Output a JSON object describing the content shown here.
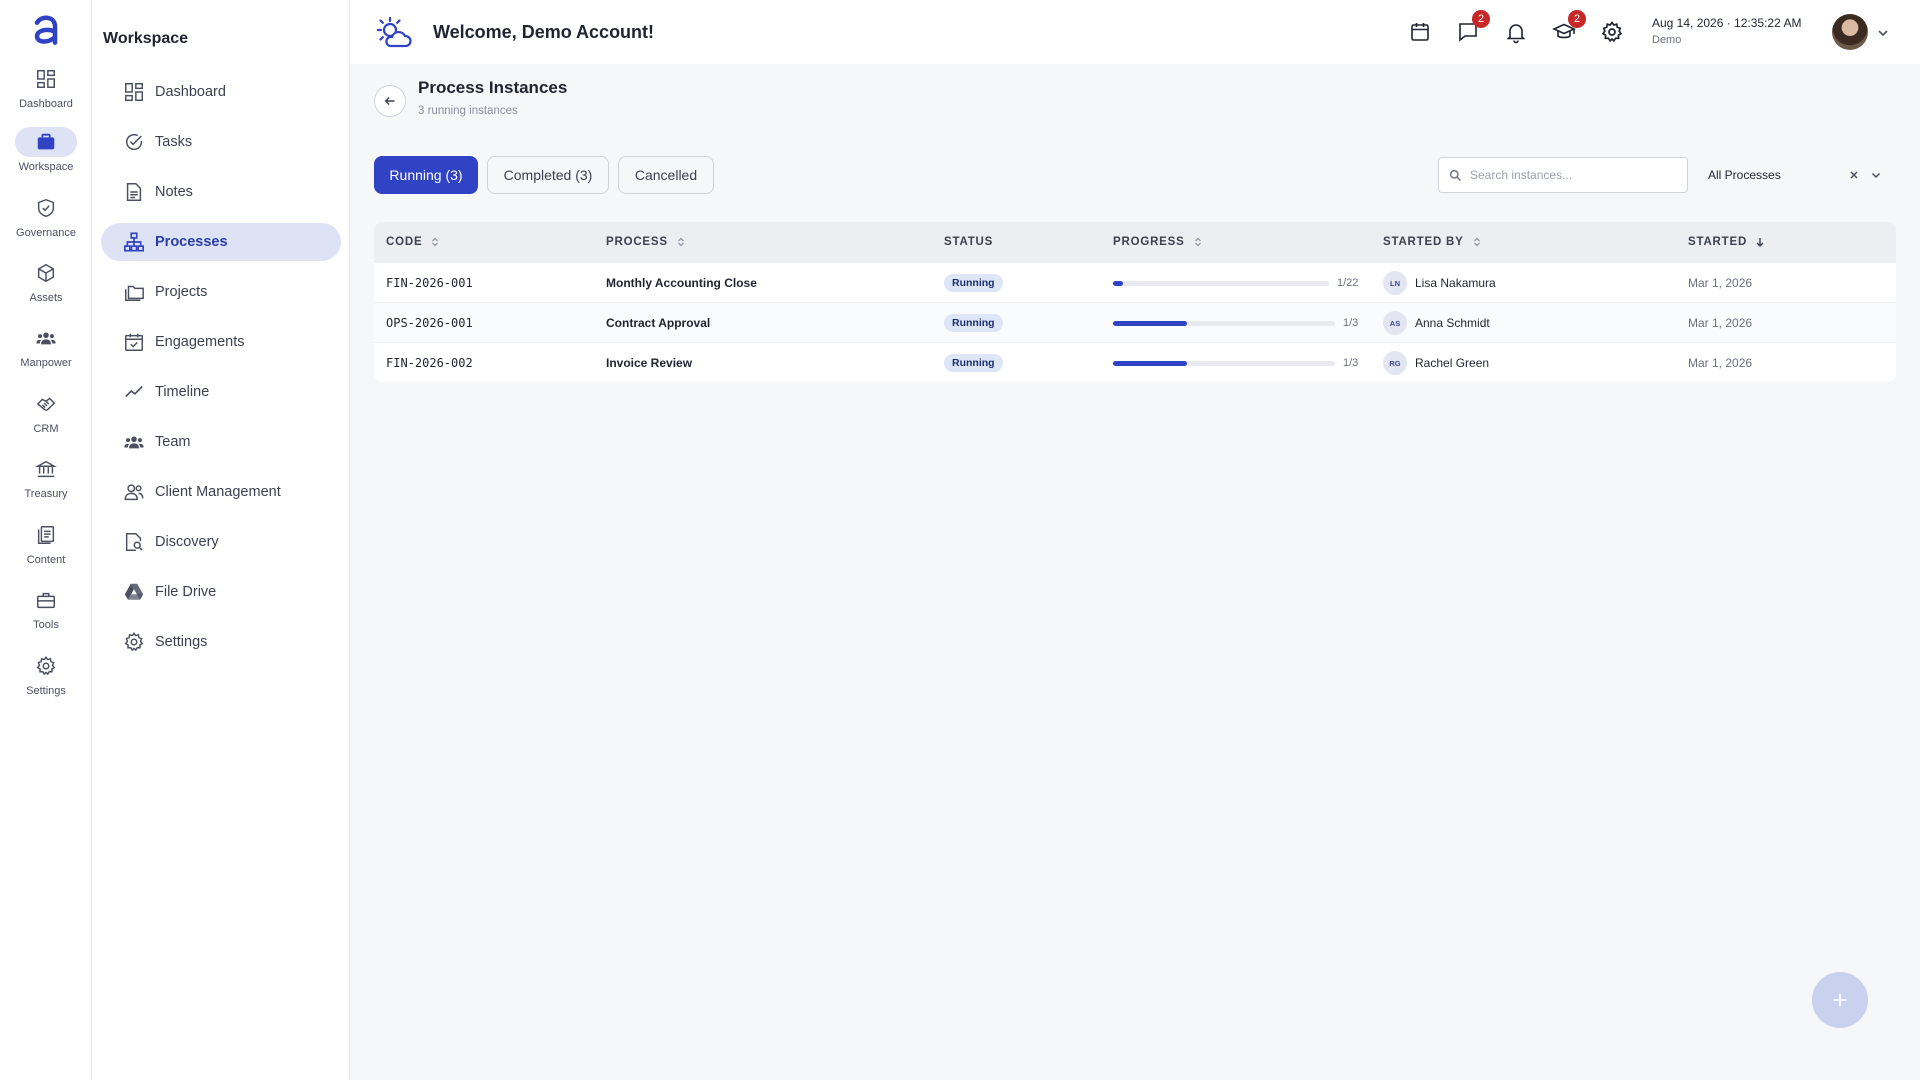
{
  "rail": {
    "items": [
      {
        "label": "Dashboard",
        "icon": "grid-icon"
      },
      {
        "label": "Workspace",
        "icon": "briefcase-icon"
      },
      {
        "label": "Governance",
        "icon": "shield-check-icon"
      },
      {
        "label": "Assets",
        "icon": "cube-icon"
      },
      {
        "label": "Manpower",
        "icon": "people-icon"
      },
      {
        "label": "CRM",
        "icon": "handshake-icon"
      },
      {
        "label": "Treasury",
        "icon": "bank-icon"
      },
      {
        "label": "Content",
        "icon": "documents-icon"
      },
      {
        "label": "Tools",
        "icon": "toolbox-icon"
      },
      {
        "label": "Settings",
        "icon": "gear-icon"
      }
    ],
    "active": "Workspace"
  },
  "sidebar": {
    "title": "Workspace",
    "items": [
      {
        "label": "Dashboard",
        "icon": "grid-icon"
      },
      {
        "label": "Tasks",
        "icon": "check-circle-icon"
      },
      {
        "label": "Notes",
        "icon": "note-icon"
      },
      {
        "label": "Processes",
        "icon": "hierarchy-icon"
      },
      {
        "label": "Projects",
        "icon": "folders-icon"
      },
      {
        "label": "Engagements",
        "icon": "calendar-check-icon"
      },
      {
        "label": "Timeline",
        "icon": "trend-icon"
      },
      {
        "label": "Team",
        "icon": "team-icon"
      },
      {
        "label": "Client Management",
        "icon": "client-icon"
      },
      {
        "label": "Discovery",
        "icon": "search-doc-icon"
      },
      {
        "label": "File Drive",
        "icon": "drive-icon"
      },
      {
        "label": "Settings",
        "icon": "gear-icon"
      }
    ],
    "active": "Processes"
  },
  "header": {
    "welcome": "Welcome, Demo Account!",
    "messages_badge": "2",
    "learning_badge": "2",
    "date": "Aug 14, 2026 · 12:35:22 AM",
    "user_sub": "Demo"
  },
  "page": {
    "title": "Process Instances",
    "subtitle": "3 running instances"
  },
  "tabs": [
    {
      "label": "Running (3)",
      "active": true
    },
    {
      "label": "Completed (3)",
      "active": false
    },
    {
      "label": "Cancelled",
      "active": false
    }
  ],
  "search": {
    "placeholder": "Search instances...",
    "value": ""
  },
  "filter": {
    "value": "All Processes"
  },
  "table": {
    "headers": {
      "code": "CODE",
      "process": "PROCESS",
      "status": "STATUS",
      "progress": "PROGRESS",
      "started_by": "STARTED BY",
      "started": "STARTED"
    },
    "rows": [
      {
        "code": "FIN-2026-001",
        "process": "Monthly Accounting Close",
        "status": "Running",
        "progress_text": "1/22",
        "progress": 0.045,
        "initials": "LN",
        "started_by": "Lisa Nakamura",
        "started": "Mar 1, 2026"
      },
      {
        "code": "OPS-2026-001",
        "process": "Contract Approval",
        "status": "Running",
        "progress_text": "1/3",
        "progress": 0.333,
        "initials": "AS",
        "started_by": "Anna Schmidt",
        "started": "Mar 1, 2026"
      },
      {
        "code": "FIN-2026-002",
        "process": "Invoice Review",
        "status": "Running",
        "progress_text": "1/3",
        "progress": 0.333,
        "initials": "RG",
        "started_by": "Rachel Green",
        "started": "Mar 1, 2026"
      }
    ]
  },
  "colors": {
    "accent": "#2f43c4",
    "active_bg": "#dde3f4",
    "badge": "#c62828",
    "status_bg": "#dce6f7"
  }
}
